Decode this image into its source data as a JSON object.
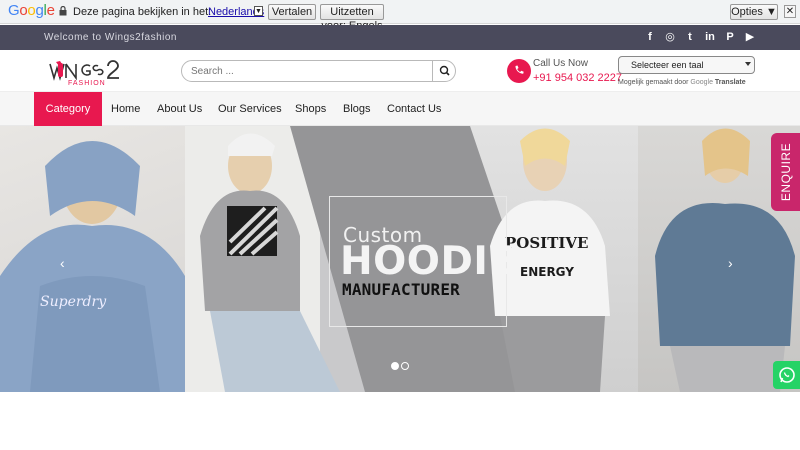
{
  "translate_bar": {
    "logo": "Google",
    "question": "Deze pagina bekijken in het:",
    "language": "Nederlands",
    "translate_button": "Vertalen",
    "never_button": "Uitzetten voor: Engels",
    "options_button": "Opties ▼",
    "close": "✕"
  },
  "top_bar": {
    "welcome": "Welcome to Wings2fashion",
    "social_icons": [
      "facebook-icon",
      "instagram-icon",
      "twitter-icon",
      "linkedin-icon",
      "pinterest-icon",
      "youtube-icon"
    ],
    "social_glyphs": [
      "f",
      "◎",
      "t",
      "in",
      "P",
      "▶"
    ]
  },
  "header": {
    "logo_alt_text": "WINGS2 FASHION",
    "search_placeholder": "Search ...",
    "call_label": "Call Us Now",
    "call_number": "+91 954 032 2227",
    "language_select": "Selecteer een taal",
    "powered_prefix": "Mogelijk gemaakt door",
    "powered_brand": "Google",
    "powered_suffix": "Translate"
  },
  "nav": {
    "category": "Category",
    "items": [
      "Home",
      "About Us",
      "Our Services",
      "Shops",
      "Blogs",
      "Contact Us"
    ]
  },
  "hero": {
    "line1": "Custom",
    "line2": "HOODIE",
    "line3": "MANUFACTURER",
    "prev": "‹",
    "next": "›",
    "active_slide": 1,
    "slide_count": 2
  },
  "enquire": "ENQUIRE",
  "colors": {
    "accent": "#e8184f",
    "top_bar": "#4a4a5c",
    "enquire": "#c9266b",
    "whatsapp": "#25d366"
  }
}
